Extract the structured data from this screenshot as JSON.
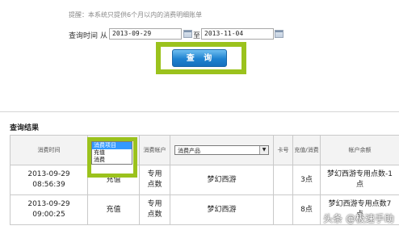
{
  "notice": "提醒：本系统只提供6个月以内的消费明细账单",
  "query": {
    "label": "查询时间",
    "from_label": "从",
    "from_value": "2013-09-29",
    "to_label": "至",
    "to_value": "2013-11-04",
    "button_label": "查 询"
  },
  "results": {
    "title": "查询结果",
    "headers": {
      "time": "消费时间",
      "item_filter_selected": "消费项目",
      "account": "消费帐户",
      "product_filter_selected": "消费产品",
      "card_no": "卡号",
      "amount": "充值/消费",
      "balance": "帐户余额"
    },
    "item_filter_options": [
      "消费项目",
      "充值",
      "消费"
    ],
    "rows": [
      {
        "time": "2013-09-29 08:56:39",
        "item": "充值",
        "account": "专用点数",
        "product": "梦幻西游",
        "card_no": "",
        "amount": "3点",
        "balance": "梦幻西游专用点数-1点"
      },
      {
        "time": "2013-09-29 09:00:25",
        "item": "充值",
        "account": "专用点数",
        "product": "梦幻西游",
        "card_no": "",
        "amount": "8点",
        "balance": "梦幻西游专用点数7点"
      }
    ]
  },
  "watermark": {
    "text": "头条 @极速手助",
    "icon": "at-sign-icon"
  },
  "colors": {
    "highlight": "#9bc21d",
    "button": "#1e82d0",
    "selected_option": "#3399ff"
  }
}
